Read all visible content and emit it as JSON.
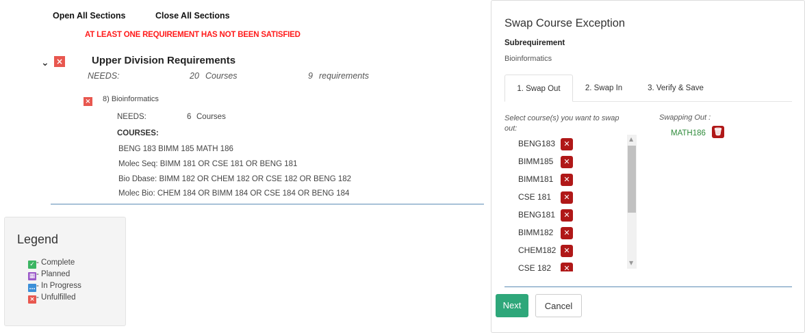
{
  "top_links": {
    "open_all": "Open All Sections",
    "close_all": "Close All Sections"
  },
  "warning": "AT LEAST ONE REQUIREMENT HAS NOT BEEN SATISFIED",
  "upper": {
    "title": "Upper Division Requirements",
    "needs_label": "NEEDS:",
    "needs_count": "20",
    "needs_unit": "Courses",
    "req_count": "9",
    "req_unit": "requirements"
  },
  "sub": {
    "title": "8) Bioinformatics",
    "needs_label": "NEEDS:",
    "needs_count": "6",
    "needs_unit": "Courses",
    "courses_label": "COURSES:",
    "courses": [
      "BENG 183 BIMM 185 MATH 186",
      "Molec Seq: BIMM 181 OR CSE 181 OR BENG 181",
      "Bio Dbase: BIMM 182 OR CHEM 182 OR CSE 182 OR BENG 182",
      "Molec Bio: CHEM 184 OR BIMM 184 OR CSE 184 OR BENG 184"
    ]
  },
  "legend": {
    "title": "Legend",
    "items": [
      {
        "label": "- Complete",
        "icon": "check-icon",
        "color": "#3cb563"
      },
      {
        "label": "- Planned",
        "icon": "calendar-icon",
        "color": "#9b59c9"
      },
      {
        "label": "- In Progress",
        "icon": "dots-icon",
        "color": "#3b8fd8"
      },
      {
        "label": "- Unfulfilled",
        "icon": "x-icon",
        "color": "#e8574f"
      }
    ]
  },
  "modal": {
    "title": "Swap Course Exception",
    "subreq_label": "Subrequirement",
    "subreq_value": "Bioinformatics",
    "tabs": [
      "1. Swap Out",
      "2. Swap In",
      "3. Verify & Save"
    ],
    "select_prompt_line1": "Select course(s) you want to swap",
    "select_prompt_line2": "out:",
    "swapping_out_label": "Swapping Out :",
    "swapping_out_course": "MATH186",
    "courses": [
      "BENG183",
      "BIMM185",
      "BIMM181",
      "CSE 181",
      "BENG181",
      "BIMM182",
      "CHEM182",
      "CSE 182"
    ],
    "next": "Next",
    "cancel": "Cancel"
  },
  "colors": {
    "warning": "#ff1a1a",
    "unfulfilled": "#e8574f",
    "remove_button": "#b01818",
    "swap_course": "#2e8b3a",
    "next_button": "#2ea77a",
    "divider": "#5b8bb5"
  }
}
